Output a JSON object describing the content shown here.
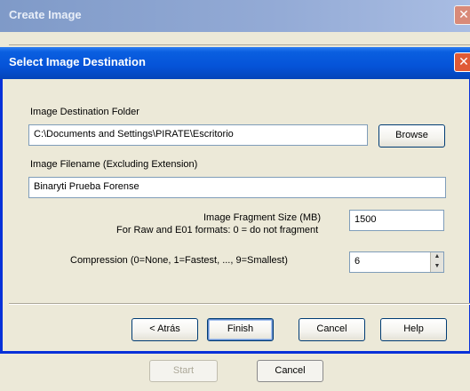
{
  "back_window": {
    "title": "Create Image",
    "close_glyph": "✕",
    "start_label": "Start",
    "cancel_label": "Cancel"
  },
  "dialog": {
    "title": "Select Image Destination",
    "close_glyph": "✕",
    "folder_label": "Image Destination Folder",
    "folder_value": "C:\\Documents and Settings\\PIRATE\\Escritorio",
    "browse_label": "Browse",
    "filename_label": "Image Filename (Excluding Extension)",
    "filename_value": "Binaryti Prueba Forense",
    "fragment_label": "Image Fragment Size (MB)",
    "fragment_note": "For Raw and E01 formats: 0 = do not fragment",
    "fragment_value": "1500",
    "compression_label": "Compression (0=None, 1=Fastest, ..., 9=Smallest)",
    "compression_value": "6",
    "buttons": {
      "back": "< Atrás",
      "finish": "Finish",
      "cancel": "Cancel",
      "help": "Help"
    }
  },
  "colors": {
    "titlebar_active": "#0553d8",
    "titlebar_inactive": "#94abd6",
    "close_active": "#e05a36",
    "dialog_bg": "#ece9d8"
  },
  "icons": {
    "close": "close-icon",
    "spin_up": "chevron-up-icon",
    "spin_down": "chevron-down-icon"
  }
}
